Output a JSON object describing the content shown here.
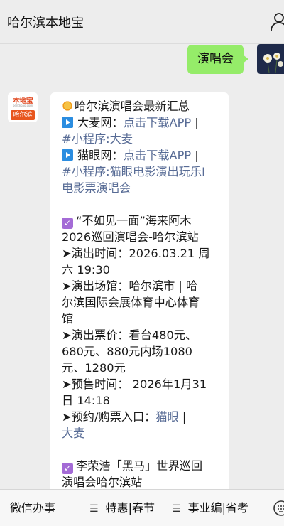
{
  "header": {
    "title": "哈尔滨本地宝"
  },
  "outgoing": {
    "text": "演唱会"
  },
  "bot": {
    "logo_top": "本地宝",
    "logo_url": "bendibao.com",
    "logo_city": "哈尔滨"
  },
  "message": {
    "title": "哈尔滨演唱会最新汇总",
    "damai_label": "大麦网：",
    "damai_link": "点击下载APP",
    "separator": "|",
    "damai_mini": "#小程序:大麦",
    "maoyan_label": "猫眼网：",
    "maoyan_link": "点击下载APP",
    "maoyan_mini_1": "#小程序:猫眼电影演出玩乐I",
    "maoyan_mini_2": "电影票演唱会",
    "ev1_title_1": "“不如见一面”海来阿木",
    "ev1_title_2": "2026巡回演唱会-哈尔滨站",
    "ev1_time_1": "➤演出时间：2026.03.21 周",
    "ev1_time_2": "六 19:30",
    "ev1_venue_1": "➤演出场馆：哈尔滨市 | 哈",
    "ev1_venue_2": "尔滨国际会展体育中心体育",
    "ev1_venue_3": "馆",
    "ev1_price_1": "➤演出票价：看台480元、",
    "ev1_price_2": "680元、880元内场1080",
    "ev1_price_3": "元、1280元",
    "ev1_presale_1": "➤预售时间： 2026年1月31",
    "ev1_presale_2": "日 14:18",
    "ev1_book_label": "➤预约/购票入口：",
    "ev1_book_maoyan": "猫眼",
    "ev1_book_damai": "大麦",
    "ev2_title_1": "李荣浩「黑马」世界巡回",
    "ev2_title_2": "演唱会哈尔滨站"
  },
  "menu": {
    "item1": "微信办事",
    "item2": "特惠|春节",
    "item3": "事业编|省考"
  },
  "icons": {
    "user": "user-icon",
    "sun": "sun-icon",
    "play": "play-icon",
    "check": "checkbox-icon",
    "burger": "menu-icon",
    "keyboard": "keyboard-icon"
  },
  "colors": {
    "outgoing_bubble": "#95ec69",
    "link": "#576b95",
    "background": "#ededed",
    "check": "#a46bd6",
    "play": "#2b8de0"
  }
}
